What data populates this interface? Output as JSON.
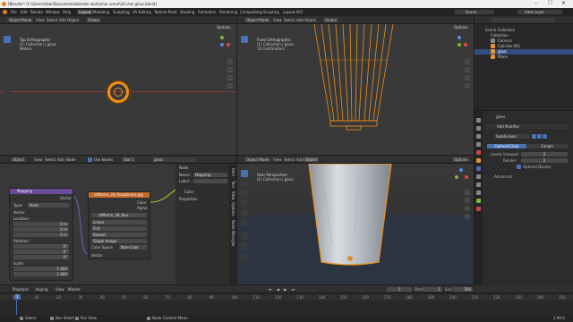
{
  "window": {
    "title": "[Blender* [C:\\Users\\stkar\\Documents\\blender work\\chai scene\\3d chai glass.blend]"
  },
  "menu": [
    "File",
    "Edit",
    "Render",
    "Window",
    "Help"
  ],
  "workspace_tabs": [
    "Layout",
    "Modeling",
    "Sculpting",
    "UV Editing",
    "Texture Paint",
    "Shading",
    "Animation",
    "Rendering",
    "Compositing",
    "Scripting",
    "Layout.001"
  ],
  "top_right": {
    "scene": "Scene",
    "view_layer": "View Layer"
  },
  "vp_header": {
    "mode": "Object Mode",
    "view": "View",
    "select": "Select",
    "add": "Add",
    "object": "Object",
    "orient": "Global",
    "options": "Options"
  },
  "vp1": {
    "name": "Top Orthographic",
    "coll": "(1) Collection | glass",
    "unit": "Meters"
  },
  "vp2": {
    "name": "Front Orthographic",
    "coll": "(1) Collection | glass",
    "unit": "10 Centimeters"
  },
  "vp3": {
    "name": "User Perspective",
    "coll": "(1) Collection | glass"
  },
  "outliner": {
    "title": "Scene Collection",
    "items": [
      "Collection",
      "Camera",
      "Cylinder.001",
      "glass",
      "Plane"
    ]
  },
  "props": {
    "object": "glass",
    "add_modifier": "Add Modifier",
    "modifier": "Subdivision",
    "catmull": "Catmull-Clark",
    "simple": "Simple",
    "levels_viewport_label": "Levels Viewport",
    "levels_viewport": "2",
    "render_label": "Render",
    "render": "2",
    "optimal": "Optimal Display",
    "advanced": "Advanced"
  },
  "node_editor": {
    "header": [
      "Object",
      "View",
      "Select",
      "Add",
      "Node"
    ],
    "use_nodes": "Use Nodes",
    "slot": "Slot 1",
    "material": "glass",
    "mapping": {
      "title": "Mapping",
      "vector_out": "Vector",
      "type_label": "Type:",
      "type": "Point",
      "vector_in": "Vector",
      "location": "Location:",
      "loc": [
        "0 m",
        "0 m",
        "0 m"
      ],
      "rotation": "Rotation:",
      "rot": [
        "0°",
        "0°",
        "0°"
      ],
      "scale": "Scale:",
      "scl": [
        "1.000",
        "1.000",
        "1.000"
      ]
    },
    "image": {
      "title": "stMartin_28_Roughness.jpg",
      "color": "Color",
      "alpha": "Alpha",
      "file": "stMartin_28_Rou...",
      "linear": "Linear",
      "flat": "Flat",
      "repeat": "Repeat",
      "single": "Single Image",
      "color_space": "Color Space",
      "color_space_val": "Non-Color",
      "vector": "Vector"
    }
  },
  "n_panel": {
    "section": "Node",
    "name_label": "Name:",
    "name": "Mapping",
    "label_label": "Label:",
    "color": "Color",
    "properties": "Properties"
  },
  "side_tabs": [
    "Item",
    "Tool",
    "View",
    "Options",
    "Node Wrangler"
  ],
  "timeline": {
    "items": [
      "Playback",
      "Keying",
      "View",
      "Marker"
    ],
    "frame": "1",
    "start_label": "Start",
    "start": "1",
    "end_label": "End",
    "end": "250",
    "ticks": [
      "0",
      "10",
      "20",
      "30",
      "40",
      "50",
      "60",
      "70",
      "80",
      "90",
      "100",
      "110",
      "120",
      "130",
      "140",
      "150",
      "160",
      "170",
      "180",
      "190",
      "200",
      "210",
      "220",
      "230",
      "240",
      "250"
    ]
  },
  "status": {
    "select": "Select",
    "box": "Box Select",
    "pan": "Pan View",
    "context": "Node Context Menu",
    "version": "2.90.0"
  }
}
